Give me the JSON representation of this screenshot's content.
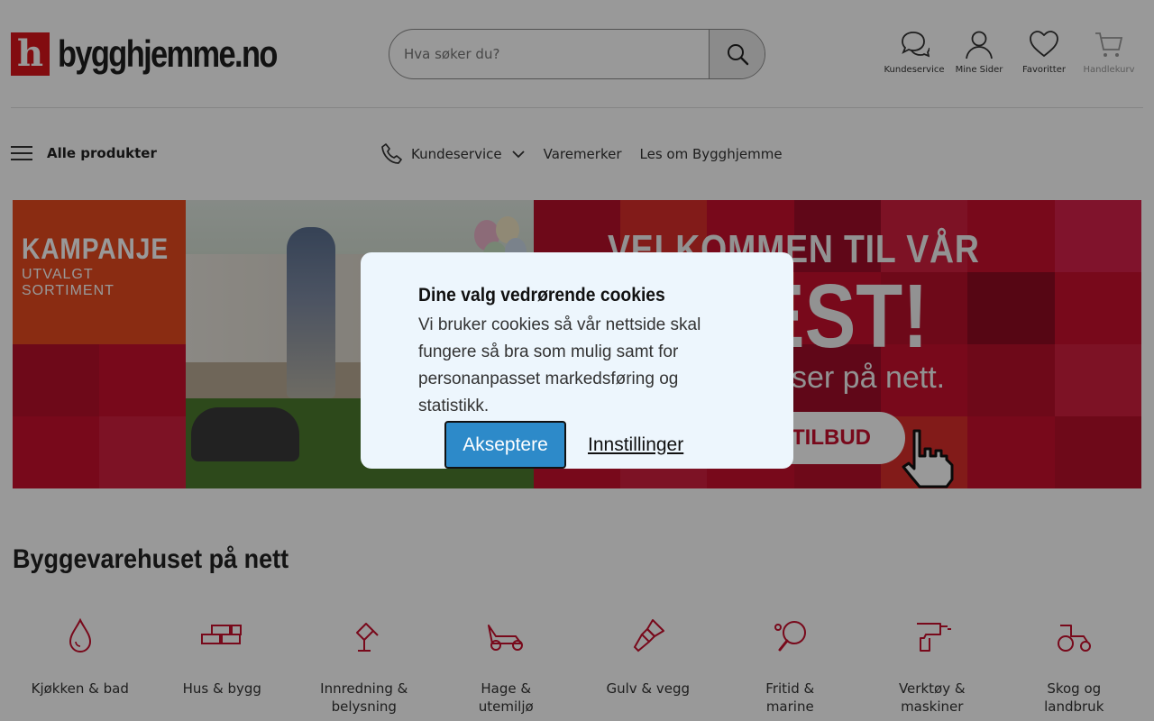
{
  "header": {
    "logo_letter": "h",
    "logo_text": "bygghjemme.no",
    "search": {
      "placeholder": "Hva søker du?"
    },
    "icons": [
      {
        "label": "Kundeservice",
        "icon": "chat-icon"
      },
      {
        "label": "Mine Sider",
        "icon": "user-icon"
      },
      {
        "label": "Favoritter",
        "icon": "heart-icon"
      },
      {
        "label": "Handlekurv",
        "icon": "cart-icon"
      }
    ]
  },
  "nav": {
    "menu_label": "Alle produkter",
    "links": [
      {
        "label": "Kundeservice",
        "icon": "phone-icon",
        "dropdown": true
      },
      {
        "label": "Varemerker"
      },
      {
        "label": "Les om Bygghjemme"
      }
    ]
  },
  "banner": {
    "kampanje_title": "KAMPANJE",
    "kampanje_sub": "UTVALGT SORTIMENT",
    "headline": "VELKOMMEN TIL VÅR",
    "big": "FEST!",
    "sub": "ser på nett.",
    "cta": "E TILBUD"
  },
  "section": {
    "title": "Byggevarehuset på nett",
    "categories": [
      {
        "label": "Kjøkken & bad",
        "icon": "drop-icon"
      },
      {
        "label": "Hus & bygg",
        "icon": "bricks-icon"
      },
      {
        "label": "Innredning & belysning",
        "icon": "lamp-icon"
      },
      {
        "label": "Hage & utemiljø",
        "icon": "lawnmower-icon"
      },
      {
        "label": "Gulv & vegg",
        "icon": "paintbrush-icon"
      },
      {
        "label": "Fritid & marine",
        "icon": "pingpong-icon"
      },
      {
        "label": "Verktøy & maskiner",
        "icon": "drill-icon"
      },
      {
        "label": "Skog og landbruk",
        "icon": "tractor-icon"
      }
    ]
  },
  "cookie_modal": {
    "title": "Dine valg vedrørende cookies",
    "text": "Vi bruker cookies så vår nettside skal fungere så bra som mulig samt for personanpasset markedsføring og statistikk.",
    "accept_label": "Akseptere",
    "settings_label": "Innstillinger"
  },
  "colors": {
    "brand_red": "#d9151b",
    "accept_blue": "#2d8ac9",
    "modal_bg": "#edf6fd",
    "icon_red": "#c8102e"
  }
}
